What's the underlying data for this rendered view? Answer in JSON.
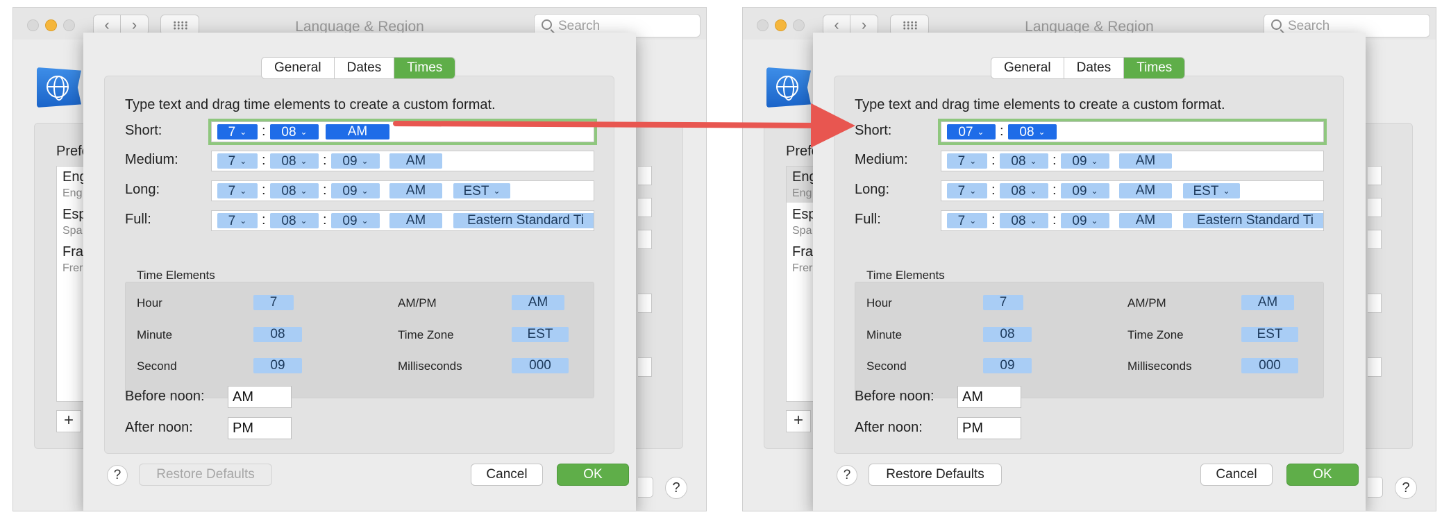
{
  "window_title": "Language & Region",
  "search_placeholder": "Search",
  "background": {
    "preferred_label": "Prefe",
    "list": [
      {
        "main": "Eng",
        "sub": "Eng"
      },
      {
        "main": "Esp",
        "sub": "Spa"
      },
      {
        "main": "Fra",
        "sub": "Frer"
      }
    ],
    "add_label": "+",
    "help_label": "?"
  },
  "tabs": [
    "General",
    "Dates",
    "Times"
  ],
  "active_tab": "Times",
  "instructions": "Type text and drag time elements to create a custom format.",
  "row_labels": {
    "short": "Short:",
    "medium": "Medium:",
    "long": "Long:",
    "full": "Full:"
  },
  "formats": {
    "medium": {
      "hour": "7",
      "minute": "08",
      "second": "09",
      "ampm": "AM"
    },
    "long": {
      "hour": "7",
      "minute": "08",
      "second": "09",
      "ampm": "AM",
      "zone": "EST"
    },
    "full": {
      "hour": "7",
      "minute": "08",
      "second": "09",
      "ampm": "AM",
      "zone": "Eastern Standard Ti"
    }
  },
  "short_before": {
    "hour": "7",
    "minute": "08",
    "ampm": "AM"
  },
  "short_after": {
    "hour": "07",
    "minute": "08"
  },
  "separator": ":",
  "time_elements": {
    "title": "Time Elements",
    "hour_label": "Hour",
    "hour_value": "7",
    "minute_label": "Minute",
    "minute_value": "08",
    "second_label": "Second",
    "second_value": "09",
    "ampm_label": "AM/PM",
    "ampm_value": "AM",
    "timezone_label": "Time Zone",
    "timezone_value": "EST",
    "ms_label": "Milliseconds",
    "ms_value": "000"
  },
  "before_noon": {
    "label": "Before noon:",
    "value": "AM"
  },
  "after_noon": {
    "label": "After noon:",
    "value": "PM"
  },
  "buttons": {
    "help": "?",
    "restore": "Restore Defaults",
    "cancel": "Cancel",
    "ok": "OK"
  },
  "colors": {
    "accent_green": "#5fae49",
    "token_selected": "#1e6ce8",
    "token": "#a9cdf5",
    "highlight": "#8fc77e",
    "arrow": "#e85650"
  }
}
